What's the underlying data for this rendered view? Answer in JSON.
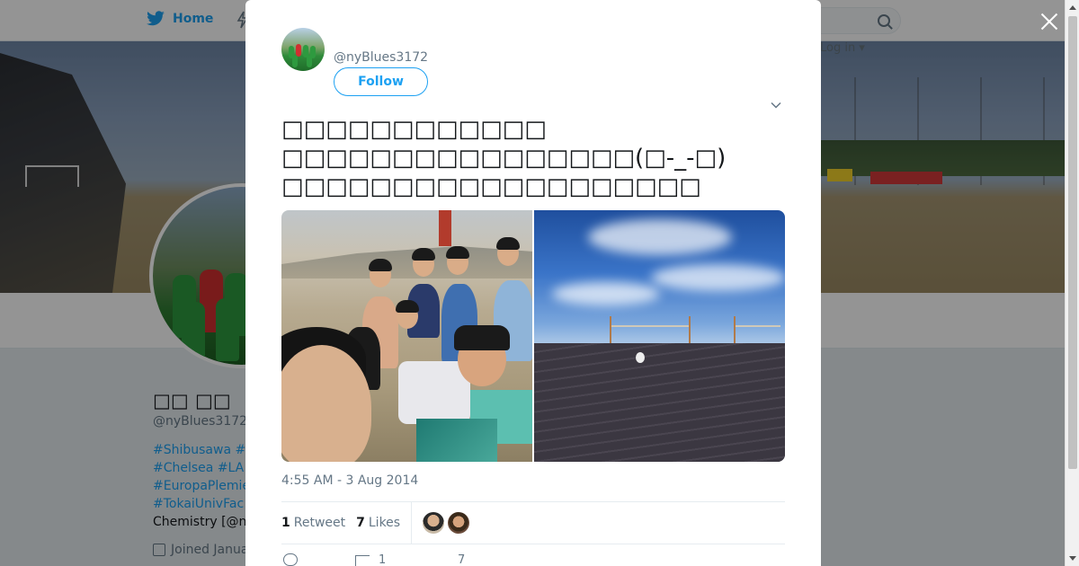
{
  "topnav": {
    "home_label": "Home",
    "login_label": "Log in ▾"
  },
  "profile": {
    "name": "□□ □□",
    "handle": "@nyBlues3172",
    "bio_lines": [
      "#Shibusawa #",
      "#Chelsea #LA",
      "#EuropaPlemie",
      "#TokaiUnivFac",
      "Chemistry [@n"
    ],
    "joined": "Joined Janua"
  },
  "tweet": {
    "handle": "@nyBlues3172",
    "follow_label": "Follow",
    "text": "□□□□□□□□□□□□\n□□□□□□□□□□□□□□□□(□-_-□)\n□□□□□□□□□□□□□□□□□□□",
    "timestamp": "4:55 AM - 3 Aug 2014",
    "retweets": "1",
    "retweet_label": "Retweet",
    "likes": "7",
    "likes_label": "Likes",
    "action_retweets": "1",
    "action_likes": "7"
  },
  "colors": {
    "brand": "#1da1f2",
    "text": "#14171a",
    "muted": "#657786"
  },
  "icons": [
    "twitter-bird-icon",
    "moments-icon",
    "search-icon",
    "close-icon",
    "chevron-down-icon",
    "calendar-icon",
    "reply-icon",
    "retweet-icon",
    "like-icon"
  ]
}
